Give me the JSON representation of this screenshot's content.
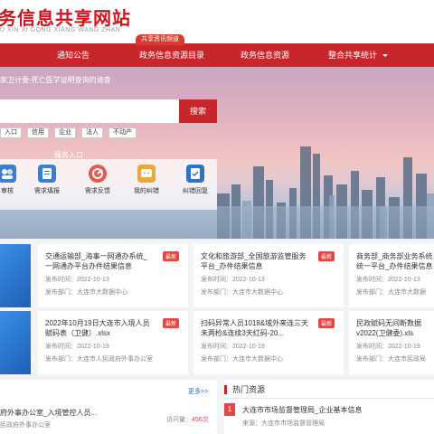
{
  "header": {
    "title": "务信息共享网站",
    "subtitle": "U XIN XI GONG XIANG WANG ZHAN",
    "sub_tab": "共享资讯频道"
  },
  "nav": {
    "items": [
      "通知公告",
      "政务信息资源目录",
      "政务信息资源",
      "整合共享统计"
    ]
  },
  "hero": {
    "notice": "家卫计委-死亡医学证明查询的请查",
    "search_button": "搜索",
    "tags": [
      "入口",
      "信用",
      "企业",
      "法人",
      "不动产"
    ],
    "service_label": "服务入口",
    "services": [
      {
        "label": "审核",
        "icon": "review-icon"
      },
      {
        "label": "需求填报",
        "icon": "demand-form-icon"
      },
      {
        "label": "需求反馈",
        "icon": "feedback-icon"
      },
      {
        "label": "我的纠错",
        "icon": "my-correction-icon"
      },
      {
        "label": "纠错回复",
        "icon": "correction-reply-icon"
      }
    ]
  },
  "cards_row1": [
    {
      "title": "交通运输部_海事一网通办系统_一网通办平台办件结果信息",
      "badge": "最新",
      "date": "发布时间：2022-10-13",
      "dept": "发布部门：大连市大数据中心"
    },
    {
      "title": "文化和旅游部_全国旅游监管服务平台_办件结果信息",
      "badge": "最新",
      "date": "发布时间：2022-10-13",
      "dept": "发布部门：大连市大数据中心"
    },
    {
      "title": "商务部_商务部业务系统统一平台_办件结果信息",
      "badge": "",
      "date": "发布时间：2022-10-13",
      "dept": "发布部门：大连市大数据"
    }
  ],
  "cards_row2": [
    {
      "title": "2022年10月19日大连市入境人员赋码表（卫健）.xlsx",
      "badge": "最新",
      "date": "发布时间：2022-10-19",
      "dept": "发布部门：大连市人民政府外事办公室"
    },
    {
      "title": "扫码异常人员1018&域外来连三天未两检&连续3天红码-20...",
      "badge": "最新",
      "date": "发布时间：2022-10-19",
      "dept": "发布部门：大连市大数据中心"
    },
    {
      "title": "民政赋码无间断数据v2022(卫健委).xls",
      "badge": "",
      "date": "发布时间：2022-10-19",
      "dept": "发布部门：大连市民政局"
    }
  ],
  "bottom_left": {
    "more": "更多>>",
    "title": "府外事办公室_入境管控人员...",
    "dept": "民政府外事办公室",
    "count_label": "访问量：",
    "count": "456次"
  },
  "bottom_right": {
    "heading": "热门资源",
    "num": "1",
    "item": "大连市市场监督管理局_企业基本信息",
    "source": "来源：大连市市场监督管理局"
  }
}
